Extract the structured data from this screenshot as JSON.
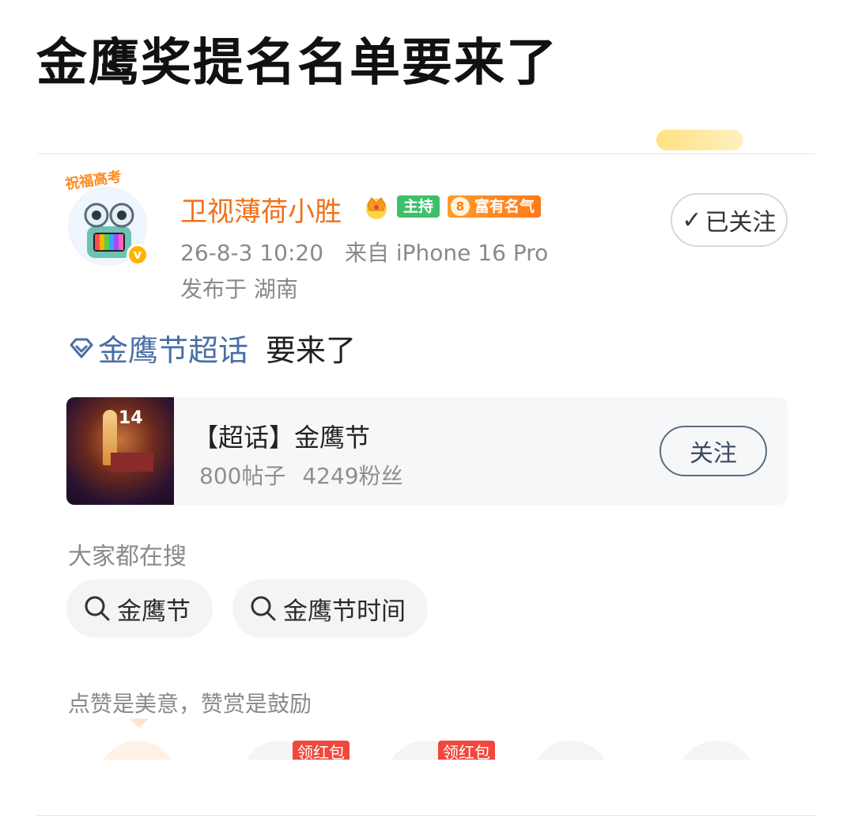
{
  "headline": "金鹰奖提名名单要来了",
  "post": {
    "avatar_banner": "祝福高考",
    "username": "卫视薄荷小胜",
    "badges": {
      "host": "主持",
      "fame_level": "8",
      "fame": "富有名气"
    },
    "follow_label": "已关注",
    "follow_check": "✓",
    "timestamp": "26-8-3 10:20",
    "source": "来自 iPhone 16 Pro",
    "location": "发布于 湖南",
    "topic_link": "金鹰节超话",
    "text": "要来了"
  },
  "supertopic_card": {
    "thumb_number": "14",
    "title": "【超话】金鹰节",
    "posts": "800帖子",
    "fans": "4249粉丝",
    "follow_label": "关注"
  },
  "search": {
    "heading": "大家都在搜",
    "chips": [
      "金鹰节",
      "金鹰节时间"
    ]
  },
  "reward": {
    "text": "点赞是美意，赞赏是鼓励",
    "gift_tags": [
      "领红包",
      "领红包"
    ]
  },
  "colors": {
    "username": "#f0701a",
    "topic_link": "#4a6fa5",
    "badge_host": "#3ec06b",
    "badge_fame": "#ff7a1a",
    "gift_tag": "#f2473c"
  }
}
